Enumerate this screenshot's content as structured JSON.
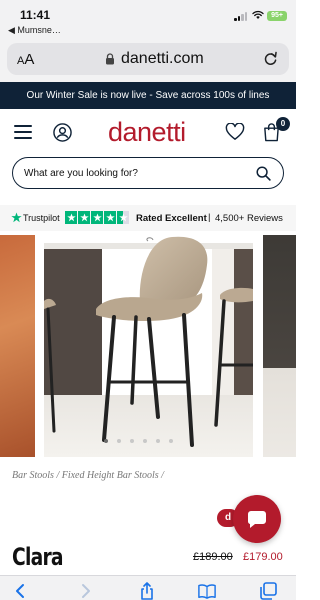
{
  "status_bar": {
    "time": "11:41",
    "back_app": "◀ Mumsne…",
    "battery": "95+"
  },
  "browser": {
    "aa_label": "AA",
    "url": "danetti.com"
  },
  "promo_banner": {
    "text": "Our Winter Sale is now live - Save across 100s of lines"
  },
  "header": {
    "logo": "danetti",
    "basket_count": "0"
  },
  "search": {
    "placeholder": "What are you looking for?"
  },
  "trustpilot": {
    "brand": "Trustpilot",
    "stars": 4.5,
    "rating": "Rated Excellent",
    "separator": "|",
    "reviews": "4,500+ Reviews",
    "color": "#00b67a"
  },
  "carousel": {
    "slide_count": 6,
    "active_index": 0
  },
  "product": {
    "breadcrumb": "Bar Stools / Fixed Height Bar Stools /",
    "name": "Clara",
    "badge": "d",
    "old_price": "£189.00",
    "new_price": "£179.00"
  },
  "colors": {
    "brand_red": "#b31b2c",
    "navy": "#0f2237"
  }
}
